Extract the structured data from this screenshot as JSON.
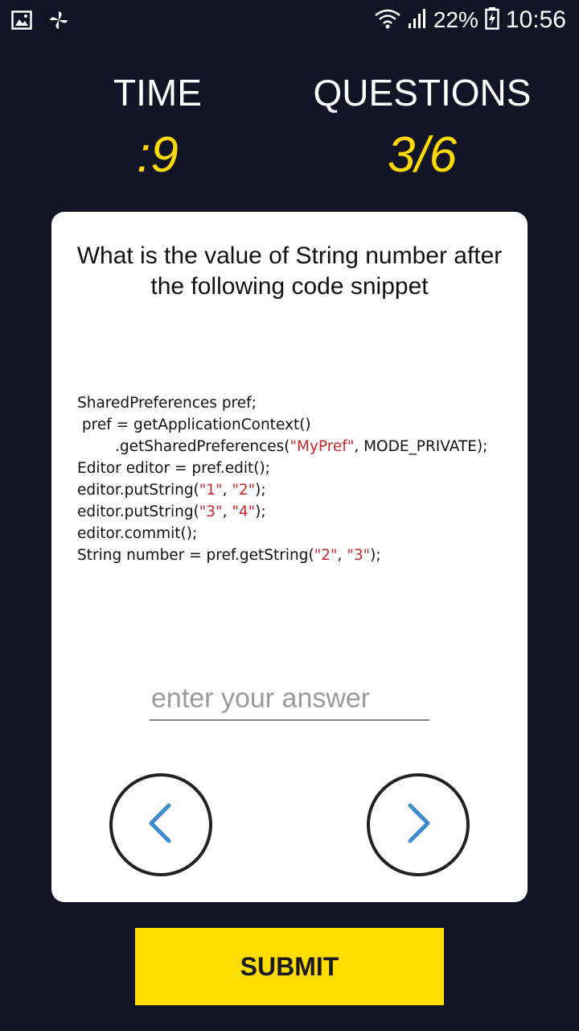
{
  "status_bar": {
    "battery": "22%",
    "time": "10:56"
  },
  "header": {
    "time_label": "TIME",
    "time_value": ":9",
    "questions_label": "QUESTIONS",
    "questions_value": "3/6"
  },
  "question": {
    "text": "What is the value of String number after the following code snippet",
    "code": {
      "l1": "SharedPreferences pref;",
      "l2": " pref = getApplicationContext()",
      "l3a": "        .getSharedPreferences(",
      "l3s": "\"MyPref\"",
      "l3b": ", MODE_PRIVATE);",
      "l4": "Editor editor = pref.edit();",
      "l5a": "editor.putString(",
      "l5s1": "\"1\"",
      "l5c": ", ",
      "l5s2": "\"2\"",
      "l5b": ");",
      "l6a": "editor.putString(",
      "l6s1": "\"3\"",
      "l6c": ", ",
      "l6s2": "\"4\"",
      "l6b": ");",
      "l7": "editor.commit();",
      "l8a": "String number = pref.getString(",
      "l8s1": "\"2\"",
      "l8c": ", ",
      "l8s2": "\"3\"",
      "l8b": ");"
    }
  },
  "answer": {
    "placeholder": "enter your answer",
    "value": ""
  },
  "navigation": {
    "prev_icon": "chevron-left-icon",
    "next_icon": "chevron-right-icon"
  },
  "submit_label": "SUBMIT",
  "colors": {
    "background": "#131425",
    "accent": "#ffd900",
    "button": "#ffdd00",
    "chevron": "#3a8cc8",
    "string_literal": "#c8282d"
  }
}
